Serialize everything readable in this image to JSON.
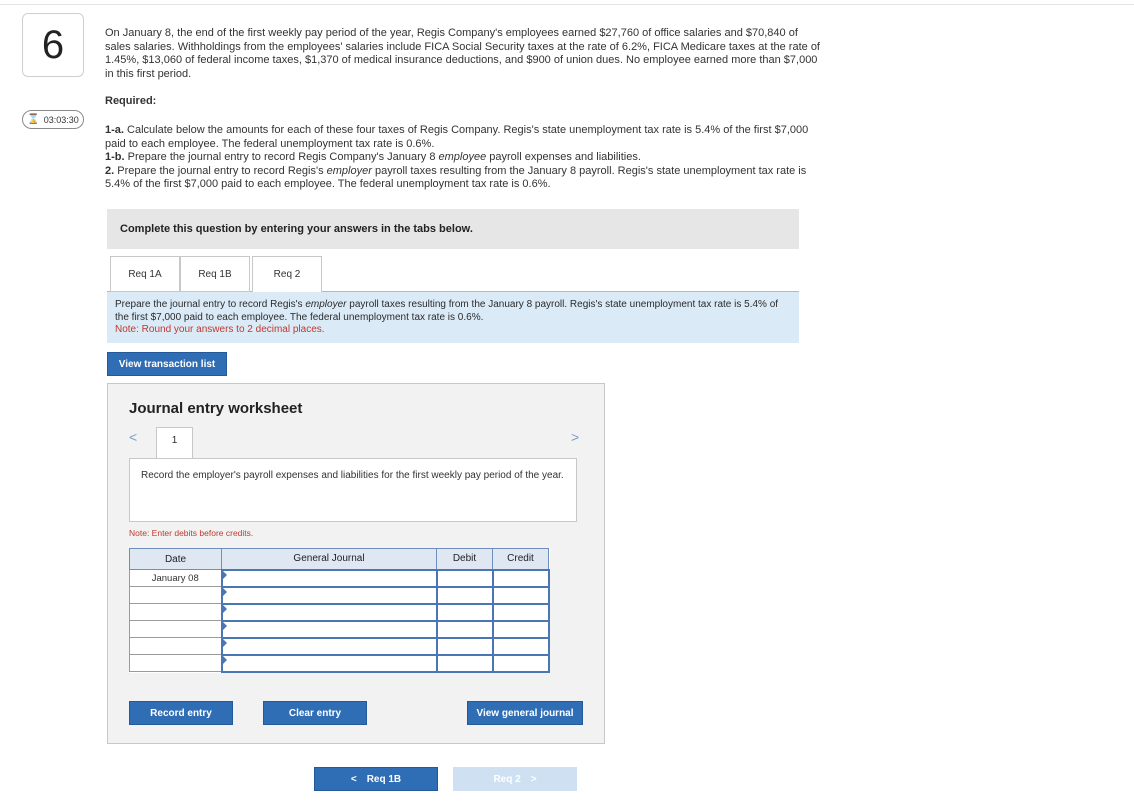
{
  "question": {
    "number": "6",
    "timer": "03:03:30",
    "problem_text": "On January 8, the end of the first weekly pay period of the year, Regis Company's employees earned $27,760 of office salaries and $70,840 of sales salaries. Withholdings from the employees' salaries include FICA Social Security taxes at the rate of 6.2%, FICA Medicare taxes at the rate of 1.45%, $13,060 of federal income taxes, $1,370 of medical insurance deductions, and $900 of union dues. No employee earned more than $7,000 in this first period.",
    "required_label": "Required:",
    "req_1a_label": "1-a.",
    "req_1a_text": "Calculate below the amounts for each of these four taxes of Regis Company. Regis's state unemployment tax rate is 5.4% of the first $7,000 paid to each employee. The federal unemployment tax rate is 0.6%.",
    "req_1b_label": "1-b.",
    "req_1b_text_pre": "Prepare the journal entry to record Regis Company's January 8",
    "req_1b_emph": "employee",
    "req_1b_text_post": "payroll expenses and liabilities.",
    "req_2_label": "2.",
    "req_2_text_pre": "Prepare the journal entry to record Regis's",
    "req_2_emph": "employer",
    "req_2_text_post": "payroll taxes resulting from the January 8 payroll. Regis's state unemployment tax rate is 5.4% of the first $7,000 paid to each employee. The federal unemployment tax rate is 0.6%."
  },
  "complete_bar": "Complete this question by entering your answers in the tabs below.",
  "tabs": [
    {
      "label": "Req 1A"
    },
    {
      "label": "Req 1B"
    },
    {
      "label": "Req 2"
    }
  ],
  "instruction": {
    "text_pre": "Prepare the journal entry to record Regis's",
    "emph": "employer",
    "text_post": "payroll taxes resulting from the January 8 payroll. Regis's state unemployment tax rate is 5.4% of the first $7,000 paid to each employee. The federal unemployment tax rate is 0.6%.",
    "note": "Note: Round your answers to 2 decimal places."
  },
  "view_transaction_list": "View transaction list",
  "worksheet": {
    "title": "Journal entry worksheet",
    "page": "1",
    "prev_icon": "chevron-left-icon",
    "next_icon": "chevron-right-icon",
    "description": "Record the employer's payroll expenses and liabilities for the first weekly pay period of the year.",
    "note": "Note: Enter debits before credits.",
    "columns": {
      "date": "Date",
      "journal": "General Journal",
      "debit": "Debit",
      "credit": "Credit"
    },
    "rows": [
      {
        "date": "January 08",
        "account": "",
        "debit": "",
        "credit": ""
      },
      {
        "date": "",
        "account": "",
        "debit": "",
        "credit": ""
      },
      {
        "date": "",
        "account": "",
        "debit": "",
        "credit": ""
      },
      {
        "date": "",
        "account": "",
        "debit": "",
        "credit": ""
      },
      {
        "date": "",
        "account": "",
        "debit": "",
        "credit": ""
      },
      {
        "date": "",
        "account": "",
        "debit": "",
        "credit": ""
      }
    ],
    "record_entry": "Record entry",
    "clear_entry": "Clear entry",
    "view_general_journal": "View general journal"
  },
  "footer_nav": {
    "prev_label": "Req 1B",
    "next_label": "Req 2"
  }
}
